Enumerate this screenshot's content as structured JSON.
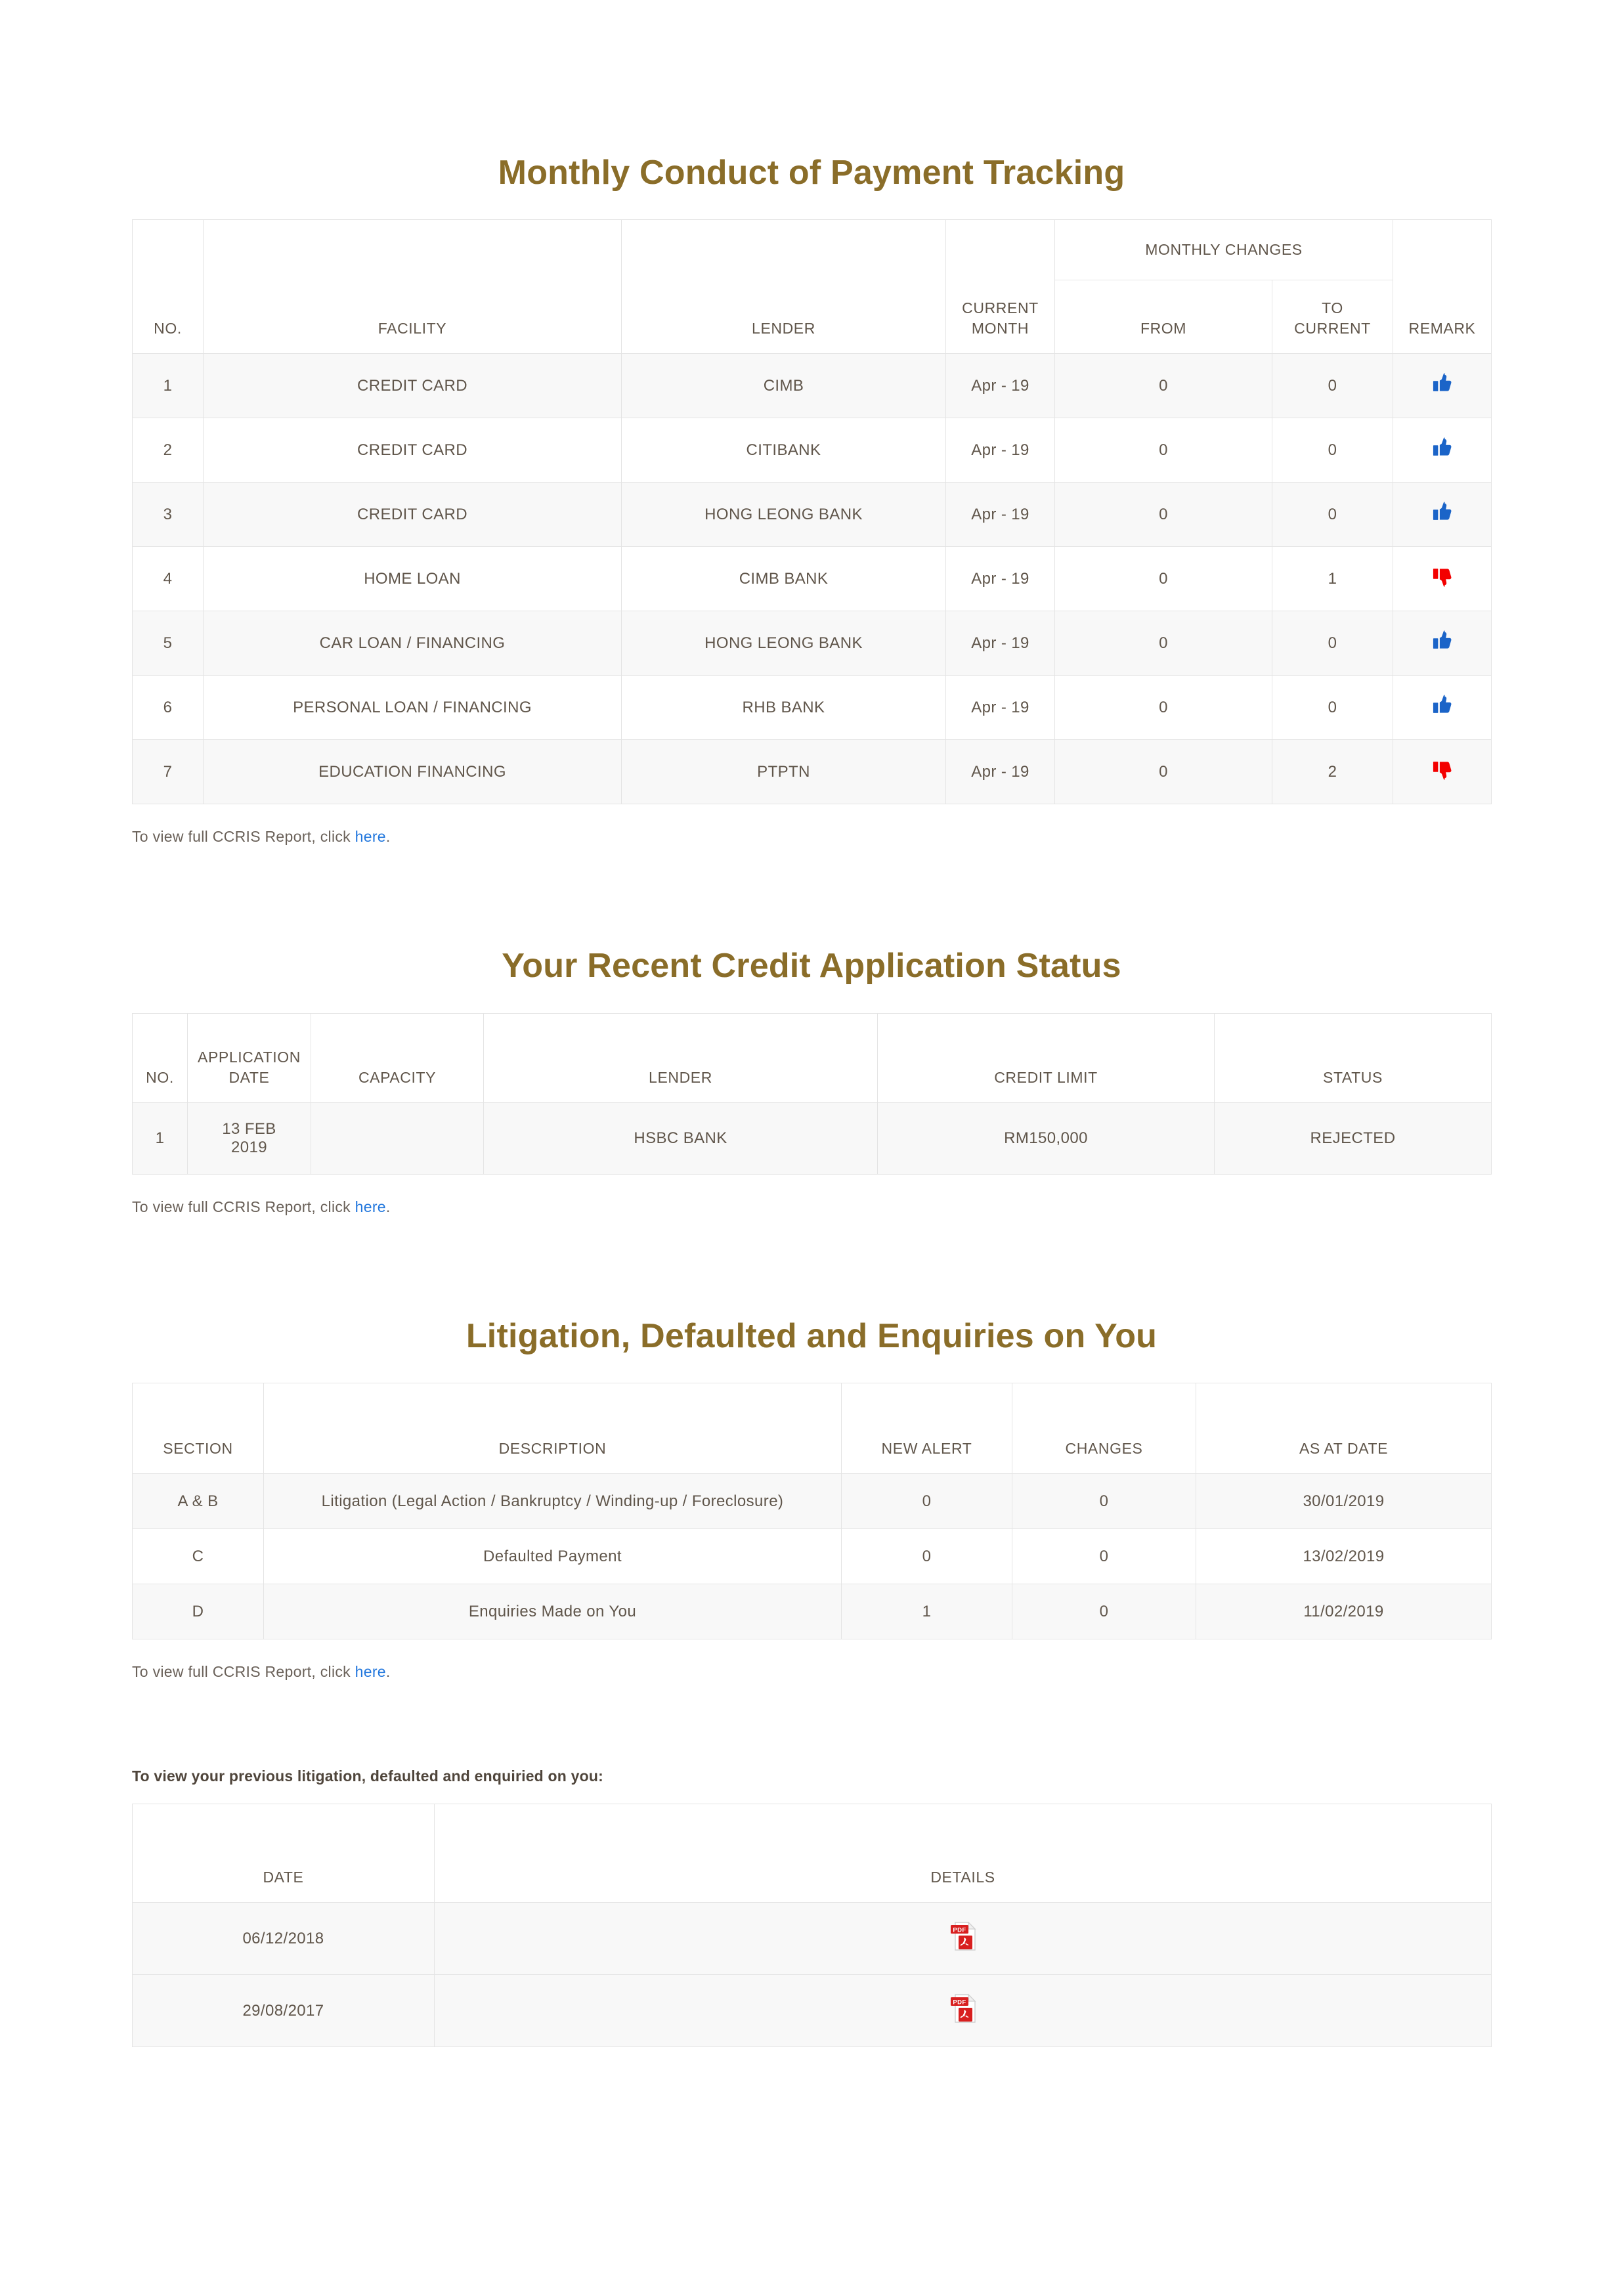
{
  "theme": {
    "heading_color": "#8a6d29",
    "text_color": "#60564b",
    "link_color": "#2277dd",
    "border_color": "#e4e4e4",
    "row_alt_color": "#f8f8f8",
    "thumbs_up_color": "#1b64c8",
    "thumbs_down_color": "#f30000",
    "pdf_icon_color": "#d81f1f"
  },
  "monthly_conduct": {
    "title": "Monthly Conduct of Payment Tracking",
    "group_header": "MONTHLY CHANGES",
    "headers": {
      "no": "NO.",
      "facility": "FACILITY",
      "lender": "LENDER",
      "current_month": "CURRENT\nMONTH",
      "current_month_line1": "CURRENT",
      "current_month_line2": "MONTH",
      "from": "FROM",
      "to_current_line1": "TO",
      "to_current_line2": "CURRENT",
      "remark": "REMARK"
    },
    "rows": [
      {
        "no": "1",
        "facility": "CREDIT CARD",
        "lender": "CIMB",
        "current_month": "Apr - 19",
        "from": "0",
        "to_current": "0",
        "remark": "thumbs-up"
      },
      {
        "no": "2",
        "facility": "CREDIT CARD",
        "lender": "CITIBANK",
        "current_month": "Apr - 19",
        "from": "0",
        "to_current": "0",
        "remark": "thumbs-up"
      },
      {
        "no": "3",
        "facility": "CREDIT CARD",
        "lender": "HONG LEONG BANK",
        "current_month": "Apr - 19",
        "from": "0",
        "to_current": "0",
        "remark": "thumbs-up"
      },
      {
        "no": "4",
        "facility": "HOME LOAN",
        "lender": "CIMB BANK",
        "current_month": "Apr - 19",
        "from": "0",
        "to_current": "1",
        "remark": "thumbs-down"
      },
      {
        "no": "5",
        "facility": "CAR LOAN / FINANCING",
        "lender": "HONG LEONG BANK",
        "current_month": "Apr - 19",
        "from": "0",
        "to_current": "0",
        "remark": "thumbs-up"
      },
      {
        "no": "6",
        "facility": "PERSONAL LOAN / FINANCING",
        "lender": "RHB BANK",
        "current_month": "Apr - 19",
        "from": "0",
        "to_current": "0",
        "remark": "thumbs-up"
      },
      {
        "no": "7",
        "facility": "EDUCATION FINANCING",
        "lender": "PTPTN",
        "current_month": "Apr - 19",
        "from": "0",
        "to_current": "2",
        "remark": "thumbs-down"
      }
    ],
    "note_prefix": "To view full CCRIS Report, click ",
    "note_link": "here",
    "note_suffix": "."
  },
  "credit_application": {
    "title": "Your Recent Credit Application Status",
    "headers": {
      "no": "NO.",
      "application_date_line1": "APPLICATION",
      "application_date_line2": "DATE",
      "capacity": "CAPACITY",
      "lender": "LENDER",
      "credit_limit": "CREDIT LIMIT",
      "status": "STATUS"
    },
    "rows": [
      {
        "no": "1",
        "application_date": "13 FEB 2019",
        "capacity": "",
        "lender": "HSBC BANK",
        "credit_limit": "RM150,000",
        "status": "REJECTED"
      }
    ],
    "note_prefix": "To view full CCRIS Report, click ",
    "note_link": "here",
    "note_suffix": "."
  },
  "litigation": {
    "title": "Litigation, Defaulted and Enquiries on You",
    "headers": {
      "section": "SECTION",
      "description": "DESCRIPTION",
      "new_alert": "NEW ALERT",
      "changes": "CHANGES",
      "as_at_date": "AS AT DATE"
    },
    "rows": [
      {
        "section": "A & B",
        "description": "Litigation (Legal Action / Bankruptcy / Winding-up / Foreclosure)",
        "new_alert": "0",
        "changes": "0",
        "as_at_date": "30/01/2019"
      },
      {
        "section": "C",
        "description": "Defaulted Payment",
        "new_alert": "0",
        "changes": "0",
        "as_at_date": "13/02/2019"
      },
      {
        "section": "D",
        "description": "Enquiries Made on You",
        "new_alert": "1",
        "changes": "0",
        "as_at_date": "11/02/2019"
      }
    ],
    "note_prefix": "To view full CCRIS Report, click ",
    "note_link": "here",
    "note_suffix": "."
  },
  "previous_records": {
    "intro": "To view your previous litigation, defaulted and enquiried on you:",
    "headers": {
      "date": "DATE",
      "details": "DETAILS"
    },
    "rows": [
      {
        "date": "06/12/2018",
        "details": "pdf-icon"
      },
      {
        "date": "29/08/2017",
        "details": "pdf-icon"
      }
    ]
  }
}
